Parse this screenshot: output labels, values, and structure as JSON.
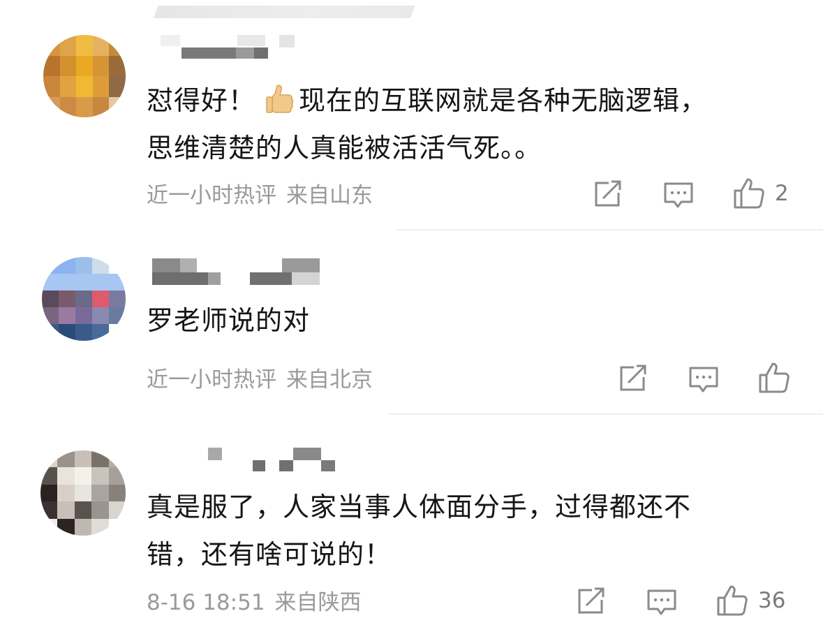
{
  "comments": [
    {
      "text_lines": [
        "怼得好！",
        "现在的互联网就是各种无脑逻辑，",
        "思维清楚的人真能被活活气死。。"
      ],
      "emoji": "thumbs-up",
      "time": "近一小时热评",
      "location": "来自山东",
      "likes": "2",
      "avatar_colors": [
        "#d89540",
        "#e0a448",
        "#f1bc43",
        "#e6b160",
        "#c48a3a",
        "#b8742f",
        "#d4922f",
        "#eaa823",
        "#d59534",
        "#9a6a3a",
        "#c9873a",
        "#e3a242",
        "#f0b833",
        "#dd9b3a",
        "#8f6a45",
        "#d49b5a",
        "#cc8a45",
        "#d99a4a",
        "#c68840",
        "#e6c8a0"
      ]
    },
    {
      "text_lines": [
        "罗老师说的对"
      ],
      "time": "近一小时热评",
      "location": "来自北京",
      "likes": "",
      "avatar_colors": [
        "#8ab3f0",
        "#8ab3f0",
        "#9bbfe8",
        "#cfdceb",
        "#ffffff",
        "#a8c6f2",
        "#a8c6f2",
        "#a8c6f2",
        "#a8c6f2",
        "#a8c6f2",
        "#5a4a5e",
        "#7a5a6a",
        "#6a6a8a",
        "#e05a6e",
        "#7a7aa0",
        "#7a6480",
        "#9a7aa0",
        "#7a6a9a",
        "#8a8ab0",
        "#6a7aa0",
        "#3a5a8a",
        "#2a4a7a",
        "#3a5a8a",
        "#4a6a9a",
        "#ffffff"
      ]
    },
    {
      "text_lines": [
        "真是服了，人家当事人体面分手，过得都还不",
        "错，还有啥可说的！"
      ],
      "time": "8-16 18:51",
      "location": "来自陕西",
      "likes": "36",
      "avatar_colors": [
        "#d8d4cc",
        "#9a928a",
        "#c8c0b8",
        "#7a726a",
        "#b8b0a8",
        "#5a524a",
        "#e8e4dc",
        "#f4f0ea",
        "#c8c4bc",
        "#a8a098",
        "#2a2220",
        "#d8d0c8",
        "#e8e4e0",
        "#a8a4a0",
        "#88807a",
        "#3a3230",
        "#c8c0b8",
        "#5a524c",
        "#9a9490",
        "#d8d4d0",
        "#f0ece8",
        "#2a2422",
        "#c0b8b0",
        "#e0dcd6",
        "#ffffff"
      ]
    }
  ]
}
